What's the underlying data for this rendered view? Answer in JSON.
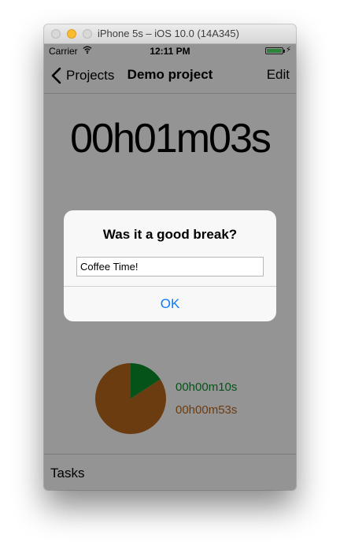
{
  "window": {
    "title": "iPhone 5s – iOS 10.0 (14A345)"
  },
  "statusbar": {
    "carrier": "Carrier",
    "time": "12:11 PM",
    "icons": [
      "wifi-icon",
      "battery-icon",
      "charging-icon"
    ],
    "battery_color": "#4cd964"
  },
  "navbar": {
    "back_label": "Projects",
    "title": "Demo project",
    "edit_label": "Edit"
  },
  "timer": {
    "value": "00h01m03s"
  },
  "summary": {
    "items": [
      {
        "label": "00h00m10s",
        "color": "#0a8a2a",
        "share": 0.159
      },
      {
        "label": "00h00m53s",
        "color": "#b5651d",
        "share": 0.841
      }
    ]
  },
  "tasks": {
    "label": "Tasks"
  },
  "alert": {
    "title": "Was it a good break?",
    "input_value": "Coffee Time!",
    "ok_label": "OK",
    "ok_color": "#0a7aff"
  }
}
